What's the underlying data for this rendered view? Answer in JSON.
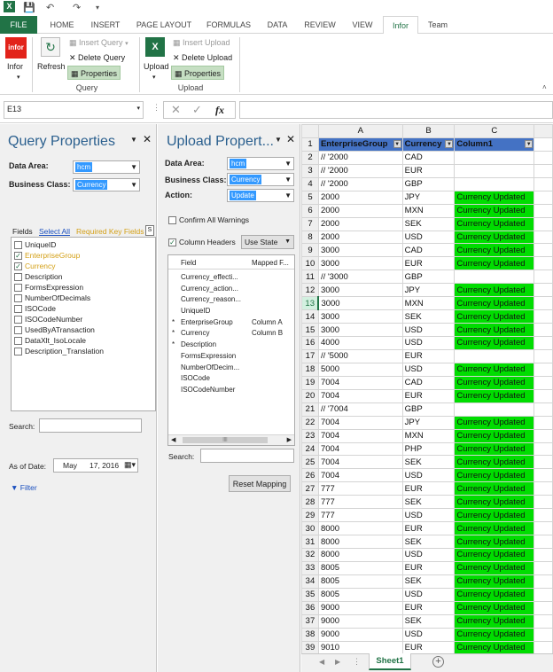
{
  "app": {
    "excel_icon": "excel-icon",
    "save_icon": "save-icon",
    "undo_icon": "undo-icon",
    "redo_icon": "redo-icon"
  },
  "tabs": [
    "FILE",
    "HOME",
    "INSERT",
    "PAGE LAYOUT",
    "FORMULAS",
    "DATA",
    "REVIEW",
    "VIEW",
    "Infor",
    "Team"
  ],
  "active_tab": "Infor",
  "ribbon": {
    "infor_label": "Infor",
    "logo_text": "infor",
    "refresh_label": "Refresh",
    "insert_query": "Insert Query",
    "delete_query": "Delete Query",
    "properties_query": "Properties",
    "query_group": "Query",
    "upload_label": "Upload",
    "insert_upload": "Insert Upload",
    "delete_upload": "Delete Upload",
    "properties_upload": "Properties",
    "upload_group": "Upload"
  },
  "formula_bar": {
    "name_box": "E13",
    "fx": "fx",
    "value": ""
  },
  "query_panel": {
    "title": "Query Properties",
    "data_area_label": "Data Area:",
    "data_area_value": "hcm",
    "business_class_label": "Business Class:",
    "business_class_value": "Currency",
    "fields_label": "Fields",
    "select_all": "Select All",
    "required_key_fields": "Required Key Fields",
    "fields": [
      {
        "name": "UniqueID",
        "checked": false,
        "key": false
      },
      {
        "name": "EnterpriseGroup",
        "checked": true,
        "key": true
      },
      {
        "name": "Currency",
        "checked": true,
        "key": true
      },
      {
        "name": "Description",
        "checked": false,
        "key": false
      },
      {
        "name": "FormsExpression",
        "checked": false,
        "key": false
      },
      {
        "name": "NumberOfDecimals",
        "checked": false,
        "key": false
      },
      {
        "name": "ISOCode",
        "checked": false,
        "key": false
      },
      {
        "name": "ISOCodeNumber",
        "checked": false,
        "key": false
      },
      {
        "name": "UsedByATransaction",
        "checked": false,
        "key": false
      },
      {
        "name": "DataXlt_IsoLocale",
        "checked": false,
        "key": false
      },
      {
        "name": "Description_Translation",
        "checked": false,
        "key": false
      }
    ],
    "search_label": "Search:",
    "as_of_date_label": "As of Date:",
    "as_of_month": "May",
    "as_of_day_year": "17, 2016",
    "filter_label": "Filter"
  },
  "upload_panel": {
    "title": "Upload Propert...",
    "data_area_label": "Data Area:",
    "data_area_value": "hcm",
    "business_class_label": "Business Class:",
    "business_class_value": "Currency",
    "action_label": "Action:",
    "action_value": "Update",
    "confirm_warnings": "Confirm All Warnings",
    "column_headers": "Column Headers",
    "use_state": "Use State",
    "col_field": "Field",
    "col_mapped": "Mapped F...",
    "rows": [
      {
        "req": "",
        "field": "Currency_effecti...",
        "mapped": ""
      },
      {
        "req": "",
        "field": "Currency_action...",
        "mapped": ""
      },
      {
        "req": "",
        "field": "Currency_reason...",
        "mapped": ""
      },
      {
        "req": "",
        "field": "UniqueID",
        "mapped": ""
      },
      {
        "req": "*",
        "field": "EnterpriseGroup",
        "mapped": "Column A"
      },
      {
        "req": "*",
        "field": "Currency",
        "mapped": "Column B"
      },
      {
        "req": "*",
        "field": "Description",
        "mapped": ""
      },
      {
        "req": "",
        "field": "FormsExpression",
        "mapped": ""
      },
      {
        "req": "",
        "field": "NumberOfDecim...",
        "mapped": ""
      },
      {
        "req": "",
        "field": "ISOCode",
        "mapped": ""
      },
      {
        "req": "",
        "field": "ISOCodeNumber",
        "mapped": ""
      }
    ],
    "scroll_thumb": "||||",
    "search_label": "Search:",
    "reset_mapping": "Reset Mapping"
  },
  "sheet": {
    "col_letters": [
      "A",
      "B",
      "C"
    ],
    "headers": [
      "EnterpriseGroup",
      "Currency",
      "Column1"
    ],
    "selected_row": "13",
    "rows": [
      {
        "n": "2",
        "a": "// '2000",
        "b": "CAD",
        "c": ""
      },
      {
        "n": "3",
        "a": "// '2000",
        "b": "EUR",
        "c": ""
      },
      {
        "n": "4",
        "a": "// '2000",
        "b": "GBP",
        "c": ""
      },
      {
        "n": "5",
        "a": "2000",
        "b": "JPY",
        "c": "Currency Updated"
      },
      {
        "n": "6",
        "a": "2000",
        "b": "MXN",
        "c": "Currency Updated"
      },
      {
        "n": "7",
        "a": "2000",
        "b": "SEK",
        "c": "Currency Updated"
      },
      {
        "n": "8",
        "a": "2000",
        "b": "USD",
        "c": "Currency Updated"
      },
      {
        "n": "9",
        "a": "3000",
        "b": "CAD",
        "c": "Currency Updated"
      },
      {
        "n": "10",
        "a": "3000",
        "b": "EUR",
        "c": "Currency Updated"
      },
      {
        "n": "11",
        "a": "// '3000",
        "b": "GBP",
        "c": ""
      },
      {
        "n": "12",
        "a": "3000",
        "b": "JPY",
        "c": "Currency Updated"
      },
      {
        "n": "13",
        "a": "3000",
        "b": "MXN",
        "c": "Currency Updated"
      },
      {
        "n": "14",
        "a": "3000",
        "b": "SEK",
        "c": "Currency Updated"
      },
      {
        "n": "15",
        "a": "3000",
        "b": "USD",
        "c": "Currency Updated"
      },
      {
        "n": "16",
        "a": "4000",
        "b": "USD",
        "c": "Currency Updated"
      },
      {
        "n": "17",
        "a": "// '5000",
        "b": "EUR",
        "c": ""
      },
      {
        "n": "18",
        "a": "5000",
        "b": "USD",
        "c": "Currency Updated"
      },
      {
        "n": "19",
        "a": "7004",
        "b": "CAD",
        "c": "Currency Updated"
      },
      {
        "n": "20",
        "a": "7004",
        "b": "EUR",
        "c": "Currency Updated"
      },
      {
        "n": "21",
        "a": "// '7004",
        "b": "GBP",
        "c": ""
      },
      {
        "n": "22",
        "a": "7004",
        "b": "JPY",
        "c": "Currency Updated"
      },
      {
        "n": "23",
        "a": "7004",
        "b": "MXN",
        "c": "Currency Updated"
      },
      {
        "n": "24",
        "a": "7004",
        "b": "PHP",
        "c": "Currency Updated"
      },
      {
        "n": "25",
        "a": "7004",
        "b": "SEK",
        "c": "Currency Updated"
      },
      {
        "n": "26",
        "a": "7004",
        "b": "USD",
        "c": "Currency Updated"
      },
      {
        "n": "27",
        "a": "777",
        "b": "EUR",
        "c": "Currency Updated"
      },
      {
        "n": "28",
        "a": "777",
        "b": "SEK",
        "c": "Currency Updated"
      },
      {
        "n": "29",
        "a": "777",
        "b": "USD",
        "c": "Currency Updated"
      },
      {
        "n": "30",
        "a": "8000",
        "b": "EUR",
        "c": "Currency Updated"
      },
      {
        "n": "31",
        "a": "8000",
        "b": "SEK",
        "c": "Currency Updated"
      },
      {
        "n": "32",
        "a": "8000",
        "b": "USD",
        "c": "Currency Updated"
      },
      {
        "n": "33",
        "a": "8005",
        "b": "EUR",
        "c": "Currency Updated"
      },
      {
        "n": "34",
        "a": "8005",
        "b": "SEK",
        "c": "Currency Updated"
      },
      {
        "n": "35",
        "a": "8005",
        "b": "USD",
        "c": "Currency Updated"
      },
      {
        "n": "36",
        "a": "9000",
        "b": "EUR",
        "c": "Currency Updated"
      },
      {
        "n": "37",
        "a": "9000",
        "b": "SEK",
        "c": "Currency Updated"
      },
      {
        "n": "38",
        "a": "9000",
        "b": "USD",
        "c": "Currency Updated"
      },
      {
        "n": "39",
        "a": "9010",
        "b": "EUR",
        "c": "Currency Updated"
      }
    ],
    "sheet_tab": "Sheet1",
    "add_sheet": "+"
  },
  "colors": {
    "excel_green": "#217346",
    "status_green": "#00dd00",
    "header_blue": "#4472c4",
    "panel_title": "#2a5f8e",
    "key_field": "#d4a017"
  }
}
